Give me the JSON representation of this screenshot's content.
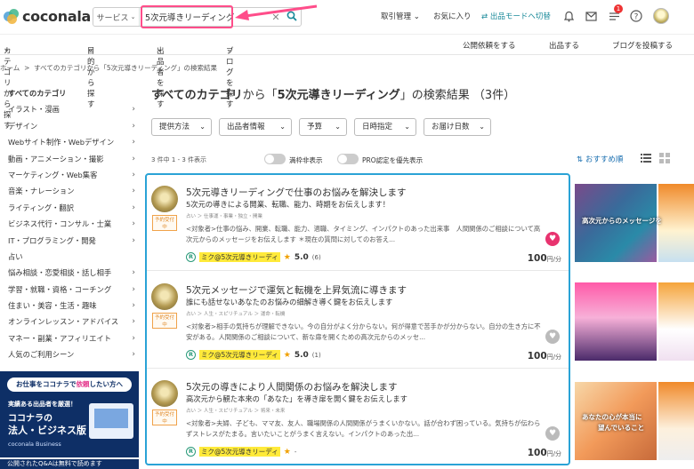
{
  "header": {
    "logo_text": "coconala",
    "service_select": "サービス",
    "search_value": "5次元導きリーディング",
    "nav": [
      "取引管理",
      "お気に入り",
      "出品モードへ切替"
    ],
    "notification_count": "1"
  },
  "subnav": {
    "left": [
      "カテゴリから探す",
      "目的から探す",
      "出品者を探す",
      "ブログを探す"
    ],
    "right": [
      "公開依頼をする",
      "出品する",
      "ブログを投稿する"
    ]
  },
  "breadcrumb": {
    "home": "ホーム",
    "sep": ">",
    "current": "すべてのカテゴリから「5次元導きリーディング」の検索結果"
  },
  "sidebar": {
    "items": [
      "すべてのカテゴリ",
      "イラスト・漫画",
      "デザイン",
      "Webサイト制作・Webデザイン",
      "動画・アニメーション・撮影",
      "マーケティング・Web集客",
      "音楽・ナレーション",
      "ライティング・翻訳",
      "ビジネス代行・コンサル・士業",
      "IT・プログラミング・開発",
      "占い",
      "悩み相談・恋愛相談・話し相手",
      "学習・就職・資格・コーチング",
      "住まい・美容・生活・趣味",
      "オンラインレッスン・アドバイス",
      "マネー・副業・アフィリエイト",
      "人気のご利用シーン"
    ],
    "banner": {
      "top_pre": "お仕事をココナラで",
      "top_hl": "依頼",
      "top_post": "したい方へ",
      "line1": "実績ある出品者を厳選！",
      "line2": "ココナラの",
      "line3": "法人・ビジネス版",
      "line4": "coconala Business"
    },
    "qa_bar": "公開されたQ&Aは無料で読めます"
  },
  "main": {
    "title_prefix": "すべてのカテゴリ",
    "title_mid": "から「",
    "title_keyword": "5次元導きリーディング",
    "title_suffix": "」の検索結果",
    "title_count": "（3件）",
    "filters": [
      "提供方法",
      "出品者情報",
      "予算",
      "日時指定",
      "お届け日数"
    ],
    "count_text": "3 件中 1 - 3 件表示",
    "toggle1": "満枠非表示",
    "toggle2": "PRO認定を優先表示",
    "sort_label": "おすすめ順"
  },
  "results": [
    {
      "tag": "予約受付中",
      "title": "5次元導きリーディングで仕事のお悩みを解決します",
      "subtitle": "5次元の導きによる開業、転職、能力、時期をお伝えします！",
      "category": "占い ＞ 仕事運・事業・独立・開業",
      "description": "<対象者>仕事の悩み、開業、転職、能力、適職、タイミング、インパクトのあった出来事　人間関係のご相談について高次元からのメッセージをお伝えします ＊現在の質問に対してのお答え...",
      "seller": "ミク@5次元導きリーディ",
      "rating": "5.0",
      "review_count": "(6)",
      "price": "100",
      "price_unit": "円/分",
      "favorite": true
    },
    {
      "tag": "予約受付中",
      "title": "5次元メッセージで運気と転機を上昇気流に導きます",
      "subtitle": "誰にも話せないあなたのお悩みの細解き導く鍵をお伝えします",
      "category": "占い ＞ 人生・スピリチュアル ＞ 運命・転機",
      "description": "<対象者>相手の気持ちが理解できない。今の自分がよく分からない。何が得意で苦手かが分からない。自分の生き方に不安がある。人間関係のご相談について、新な扉を開くための高次元からのメッセ...",
      "seller": "ミク@5次元導きリーディ",
      "rating": "5.0",
      "review_count": "(1)",
      "price": "100",
      "price_unit": "円/分",
      "favorite": false
    },
    {
      "tag": "予約受付中",
      "title": "5次元の導きにより人間関係のお悩みを解決します",
      "subtitle": "高次元から観た本来の「あなた」を導き扉を開く鍵をお伝えします",
      "category": "占い ＞ 人生・スピリチュアル ＞ 将来・未来",
      "description": "<対象者>夫婦、子ども、ママ友、友人、職場関係の人間関係がうまくいかない。話が合わず困っている。気持ちが伝わらずストレスがたまる。言いたいことがうまく言えない。インパクトのあった出...",
      "seller": "ミク@5次元導きリーディ",
      "rating": "",
      "review_count": "",
      "price": "100",
      "price_unit": "円/分",
      "favorite": false
    }
  ],
  "thumbs": {
    "t1": "高次元からのメッセージを",
    "t3a": "あなたの心が本当に",
    "t3b": "望んでいること"
  },
  "colors": {
    "accent": "#1a8a9a",
    "highlight": "#ff4d8a",
    "results_border": "#2aa3d6",
    "seller_bg": "#ffea3a",
    "fav_on": "#e8336f",
    "fav_off": "#bbbbbb"
  }
}
